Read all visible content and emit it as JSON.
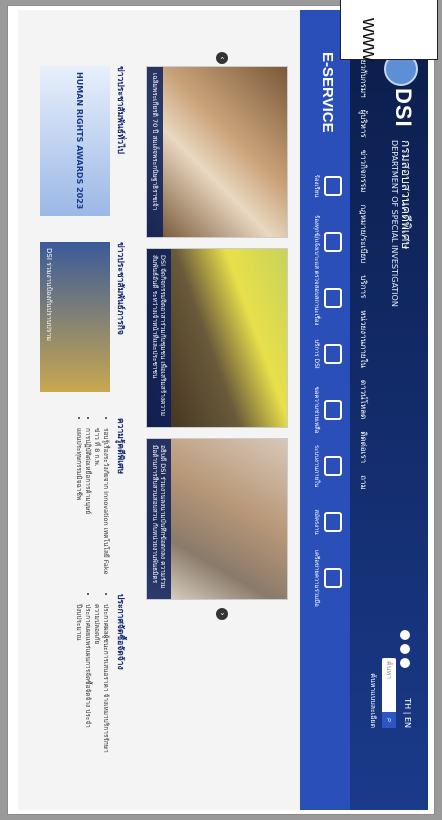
{
  "url_label": "www",
  "header": {
    "logo_mark": "DSI",
    "org_name_th": "กรมสอบสวนคดีพิเศษ",
    "org_name_en": "DEPARTMENT OF SPECIAL INVESTIGATION",
    "lang": "TH | EN",
    "search_placeholder": "ค้นหา",
    "search_icon": "search-icon",
    "advanced_search": "ค้นหาแบบละเอียด"
  },
  "nav": [
    "เกี่ยวกับกรมฯ",
    "ผู้บริหาร",
    "ข่าวกิจกรรม",
    "กฎหมาย/ระเบียบ",
    "บริการ",
    "หน่วยงานภายใน",
    "ดาวน์โหลด",
    "ติดต่อเรา",
    "ถาม"
  ],
  "eservice": {
    "title": "E-SERVICE",
    "items": [
      "ร้องเรียน",
      "ร้องทุกข์/แจ้งเบาะแส",
      "ตรวจสอบสถานะเรื่อง",
      "บริการ DSI",
      "ขอความช่วยเหลือ",
      "ระบบงานภายใน",
      "สมัครงาน",
      "เครือข่ายความร่วมมือ"
    ]
  },
  "photos": [
    {
      "caption": "เฉลิมพระเกียรติ 70 ปี สมเด็จพระกนิษฐาธิราชเจ้า"
    },
    {
      "caption": "DSI จัดกิจกรรมจิตอาสาร่วมกับชุมชน เพื่อเสริมสร้างความสัมพันธ์อันดี ระหว่างเจ้าหน้าที่และประชาชน"
    },
    {
      "caption": "อธิบดี DSI ร่วมงานลงนามบันทึกข้อตกลง ความร่วมมือด้านการสืบสวนสอบสวน กับหน่วยงานพันธมิตร"
    }
  ],
  "news": [
    {
      "title": "ข่าวประชาสัมพันธ์ทั่วไป",
      "icon": "megaphone-icon",
      "banner": "HUMAN RIGHTS AWARDS 2023"
    },
    {
      "title": "ข่าวประชาสัมพันธ์ภารกิจ",
      "icon": "briefcase-icon",
      "banner": "DSI ร่วมงานป้องกันปราบปราม"
    },
    {
      "title": "ความรู้คดีพิเศษ",
      "icon": "lightbulb-icon",
      "bullets": [
        "รอบรู้เรื่องระวังภัยจาก Innovation เทคโนโลยี Fake ข่าว ที่ 8 ก.พ.",
        "การปฏิบัติต่อเหยื่อการค้ามนุษย์",
        "แผนประทุษกรรมมิจฉาชีพ"
      ]
    }
  ],
  "announce": {
    "title": "ประกาศจัดซื้อจัดจ้าง",
    "icon": "megaphone-icon",
    "bullets": [
      "ประกาศผลผู้ชนะการเสนอราคา จ้างเหมาบริการรักษาความปลอดภัย",
      "ประกาศเผยแพร่แผนการจัดซื้อจัดจ้าง ประจำปีงบประมาณ"
    ]
  }
}
